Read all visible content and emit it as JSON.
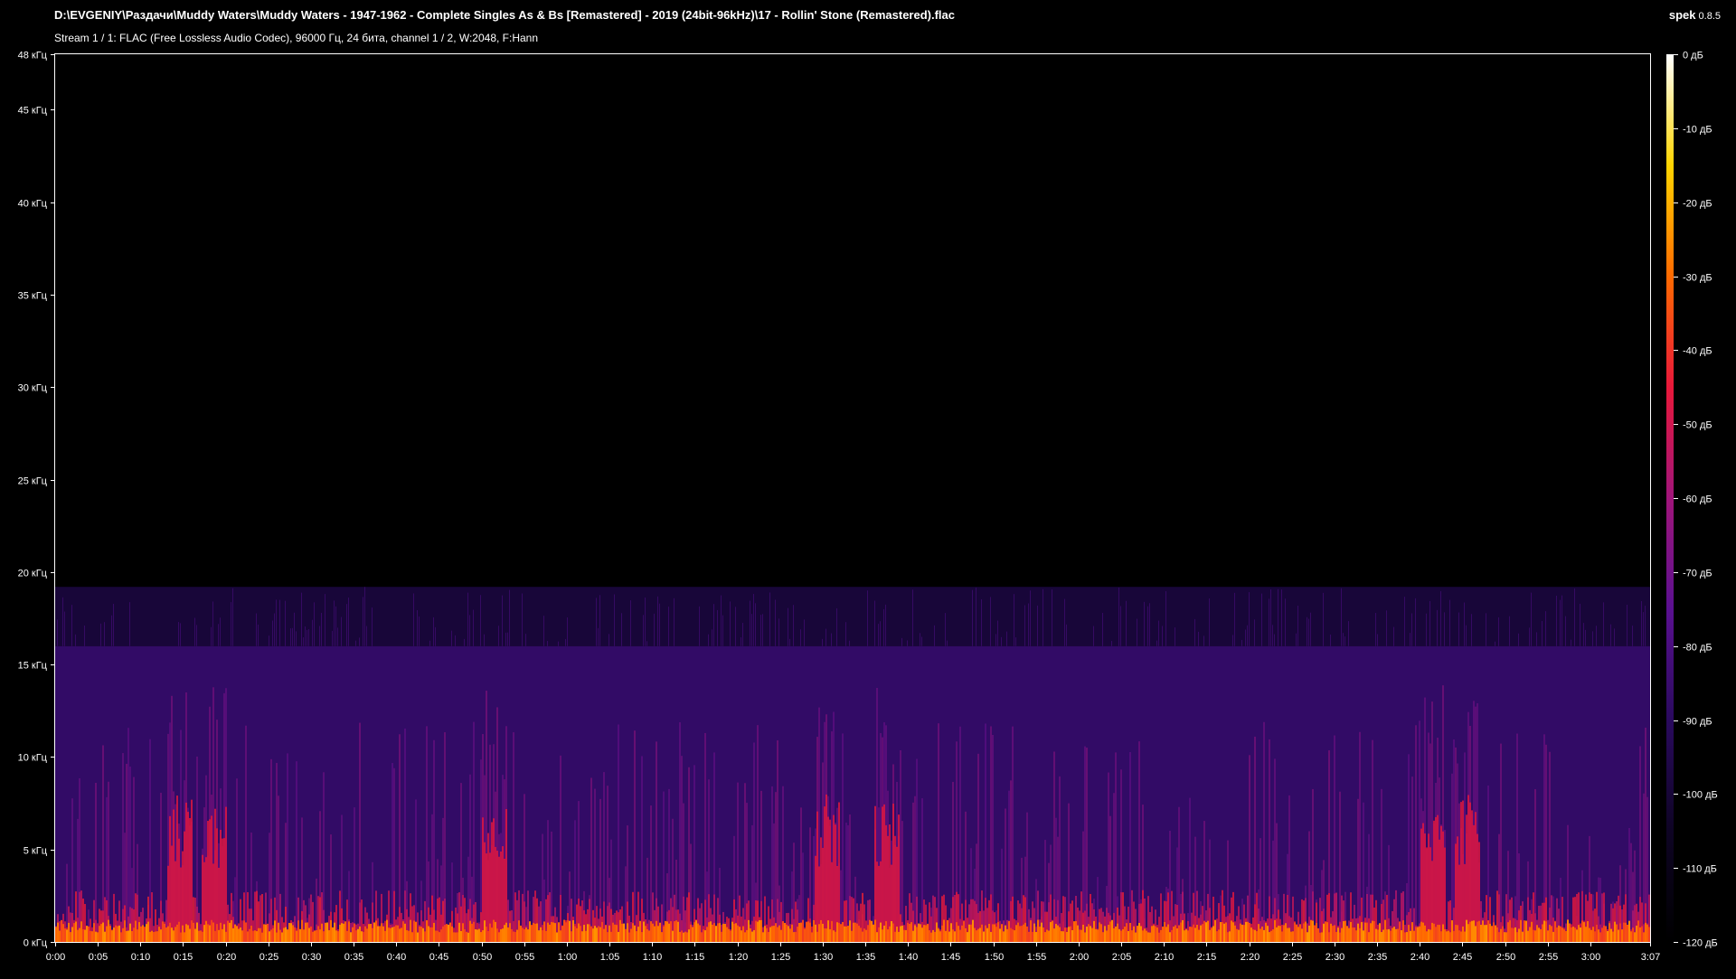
{
  "header": {
    "file_path": "D:\\EVGENIY\\Раздачи\\Muddy Waters\\Muddy Waters - 1947-1962 - Complete Singles As & Bs [Remastered] - 2019 (24bit-96kHz)\\17 - Rollin' Stone (Remastered).flac",
    "stream_info": "Stream 1 / 1: FLAC (Free Lossless Audio Codec), 96000 Гц, 24 бита, channel 1 / 2, W:2048, F:Hann",
    "app_name": "spek",
    "app_version": "0.8.5"
  },
  "chart_data": {
    "type": "heatmap",
    "title": "",
    "xlabel": "",
    "ylabel": "",
    "x_range_seconds": [
      0,
      187
    ],
    "y_range_khz": [
      0,
      48
    ],
    "y_ticks": [
      "0 кГц",
      "5 кГц",
      "10 кГц",
      "15 кГц",
      "20 кГц",
      "25 кГц",
      "30 кГц",
      "35 кГц",
      "40 кГц",
      "45 кГц",
      "48 кГц"
    ],
    "y_tick_values": [
      0,
      5,
      10,
      15,
      20,
      25,
      30,
      35,
      40,
      45,
      48
    ],
    "x_ticks": [
      "0:00",
      "0:05",
      "0:10",
      "0:15",
      "0:20",
      "0:25",
      "0:30",
      "0:35",
      "0:40",
      "0:45",
      "0:50",
      "0:55",
      "1:00",
      "1:05",
      "1:10",
      "1:15",
      "1:20",
      "1:25",
      "1:30",
      "1:35",
      "1:40",
      "1:45",
      "1:50",
      "1:55",
      "2:00",
      "2:05",
      "2:10",
      "2:15",
      "2:20",
      "2:25",
      "2:30",
      "2:35",
      "2:40",
      "2:45",
      "2:50",
      "2:55",
      "3:00",
      "3:07"
    ],
    "x_tick_values": [
      0,
      5,
      10,
      15,
      20,
      25,
      30,
      35,
      40,
      45,
      50,
      55,
      60,
      65,
      70,
      75,
      80,
      85,
      90,
      95,
      100,
      105,
      110,
      115,
      120,
      125,
      130,
      135,
      140,
      145,
      150,
      155,
      160,
      165,
      170,
      175,
      180,
      187
    ],
    "colorbar_ticks": [
      "0 дБ",
      "-10 дБ",
      "-20 дБ",
      "-30 дБ",
      "-40 дБ",
      "-50 дБ",
      "-60 дБ",
      "-70 дБ",
      "-80 дБ",
      "-90 дБ",
      "-100 дБ",
      "-110 дБ",
      "-120 дБ"
    ],
    "colorbar_values": [
      0,
      -10,
      -20,
      -30,
      -40,
      -50,
      -60,
      -70,
      -80,
      -90,
      -100,
      -110,
      -120
    ],
    "db_range": [
      -120,
      0
    ],
    "spectrum_cutoff_khz": 19.2,
    "dense_band_top_khz": 16,
    "loud_segments_seconds": [
      [
        13,
        16
      ],
      [
        17,
        20
      ],
      [
        50,
        53
      ],
      [
        89,
        92
      ],
      [
        96,
        99
      ],
      [
        160,
        163
      ],
      [
        164,
        167
      ]
    ],
    "colors": {
      "background": "#000000",
      "frame": "#ffffff",
      "palette": [
        "#000000",
        "#0e0424",
        "#2a0a5e",
        "#5a1090",
        "#a0157a",
        "#e8183a",
        "#ff6a00",
        "#ffd400",
        "#ffffff"
      ]
    }
  }
}
